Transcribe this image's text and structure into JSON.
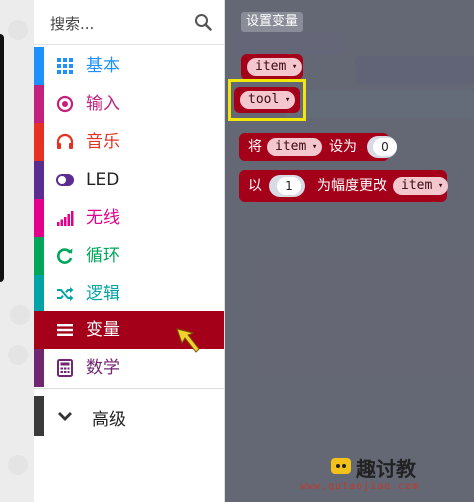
{
  "search": {
    "placeholder": "搜索..."
  },
  "categories": [
    {
      "label": "基本",
      "icon": "grid-icon",
      "color": "#1e90ff"
    },
    {
      "label": "输入",
      "icon": "target-icon",
      "color": "#c2227e"
    },
    {
      "label": "音乐",
      "icon": "headphones-icon",
      "color": "#e63022"
    },
    {
      "label": "LED",
      "icon": "toggle-icon",
      "color": "#5c2d91"
    },
    {
      "label": "无线",
      "icon": "signal-bars-icon",
      "color": "#e3008c"
    },
    {
      "label": "循环",
      "icon": "loop-icon",
      "color": "#00a65a"
    },
    {
      "label": "逻辑",
      "icon": "shuffle-icon",
      "color": "#00a4a6"
    },
    {
      "label": "变量",
      "icon": "list-icon",
      "color": "#a5001a",
      "selected": true
    },
    {
      "label": "数学",
      "icon": "calculator-icon",
      "color": "#712672"
    }
  ],
  "advanced": {
    "label": "高级",
    "icon": "chevron-down-icon"
  },
  "flyout": {
    "button_label": "设置变量",
    "variables": [
      "item",
      "tool"
    ],
    "set_block": {
      "prefix": "将",
      "variable": "item",
      "middle": "设为",
      "value": "0"
    },
    "change_block": {
      "prefix": "以",
      "value": "1",
      "middle": "为幅度更改",
      "variable": "item"
    }
  },
  "watermark": {
    "brand": "趣讨教",
    "url": "www.qutaojiao.com"
  }
}
